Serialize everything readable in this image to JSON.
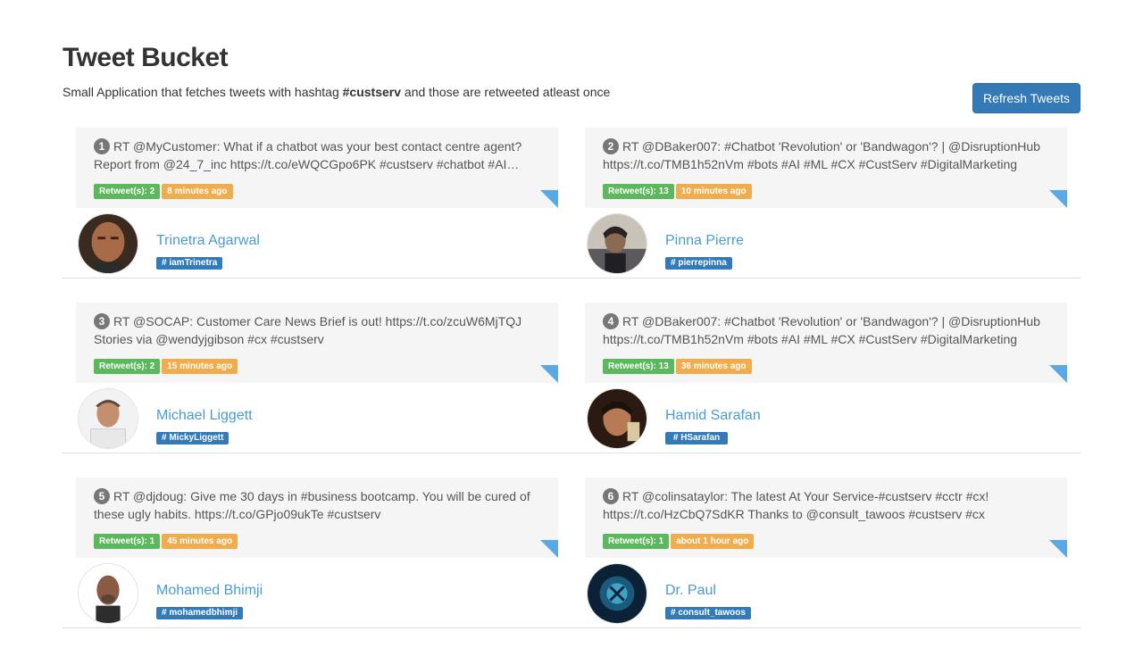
{
  "header": {
    "title": "Tweet Bucket",
    "subtitle_pre": "Small Application that fetches tweets with hashtag ",
    "subtitle_hashtag": "#custserv",
    "subtitle_post": " and those are retweeted atleast once",
    "refresh_label": "Refresh Tweets"
  },
  "tweets": [
    {
      "num": "1",
      "text": "RT @MyCustomer: What if a chatbot was your best contact centre agent? Report from @24_7_inc https://t.co/eWQCGpo6PK #custserv #chatbot #AI…",
      "retweets": "Retweet(s): 2",
      "time": "8 minutes ago",
      "user": "Trinetra Agarwal",
      "handle": "# iamTrinetra"
    },
    {
      "num": "2",
      "text": "RT @DBaker007: #Chatbot 'Revolution' or 'Bandwagon'? | @DisruptionHub https://t.co/TMB1h52nVm #bots #AI #ML #CX #CustServ #DigitalMarketing",
      "retweets": "Retweet(s): 13",
      "time": "10 minutes ago",
      "user": "Pinna Pierre",
      "handle": "# pierrepinna"
    },
    {
      "num": "3",
      "text": "RT @SOCAP: Customer Care News Brief is out! https://t.co/zcuW6MjTQJ Stories via @wendyjgibson #cx #custserv",
      "retweets": "Retweet(s): 2",
      "time": "15 minutes ago",
      "user": "Michael Liggett",
      "handle": "# MickyLiggett"
    },
    {
      "num": "4",
      "text": "RT @DBaker007: #Chatbot 'Revolution' or 'Bandwagon'? | @DisruptionHub https://t.co/TMB1h52nVm #bots #AI #ML #CX #CustServ #DigitalMarketing",
      "retweets": "Retweet(s): 13",
      "time": "36 minutes ago",
      "user": "Hamid Sarafan",
      "handle": "# HSarafan"
    },
    {
      "num": "5",
      "text": "RT @djdoug: Give me 30 days in #business bootcamp. You will be cured of these ugly habits. https://t.co/GPjo09ukTe #custserv",
      "retweets": "Retweet(s): 1",
      "time": "45 minutes ago",
      "user": "Mohamed Bhimji",
      "handle": "# mohamedbhimji"
    },
    {
      "num": "6",
      "text": "RT @colinsataylor: The latest At Your Service-#custserv #cctr #cx! https://t.co/HzCbQ7SdKR Thanks to @consult_tawoos #custserv #cx",
      "retweets": "Retweet(s): 1",
      "time": "about 1 hour ago",
      "user": "Dr. Paul",
      "handle": "# consult_tawoos"
    }
  ]
}
